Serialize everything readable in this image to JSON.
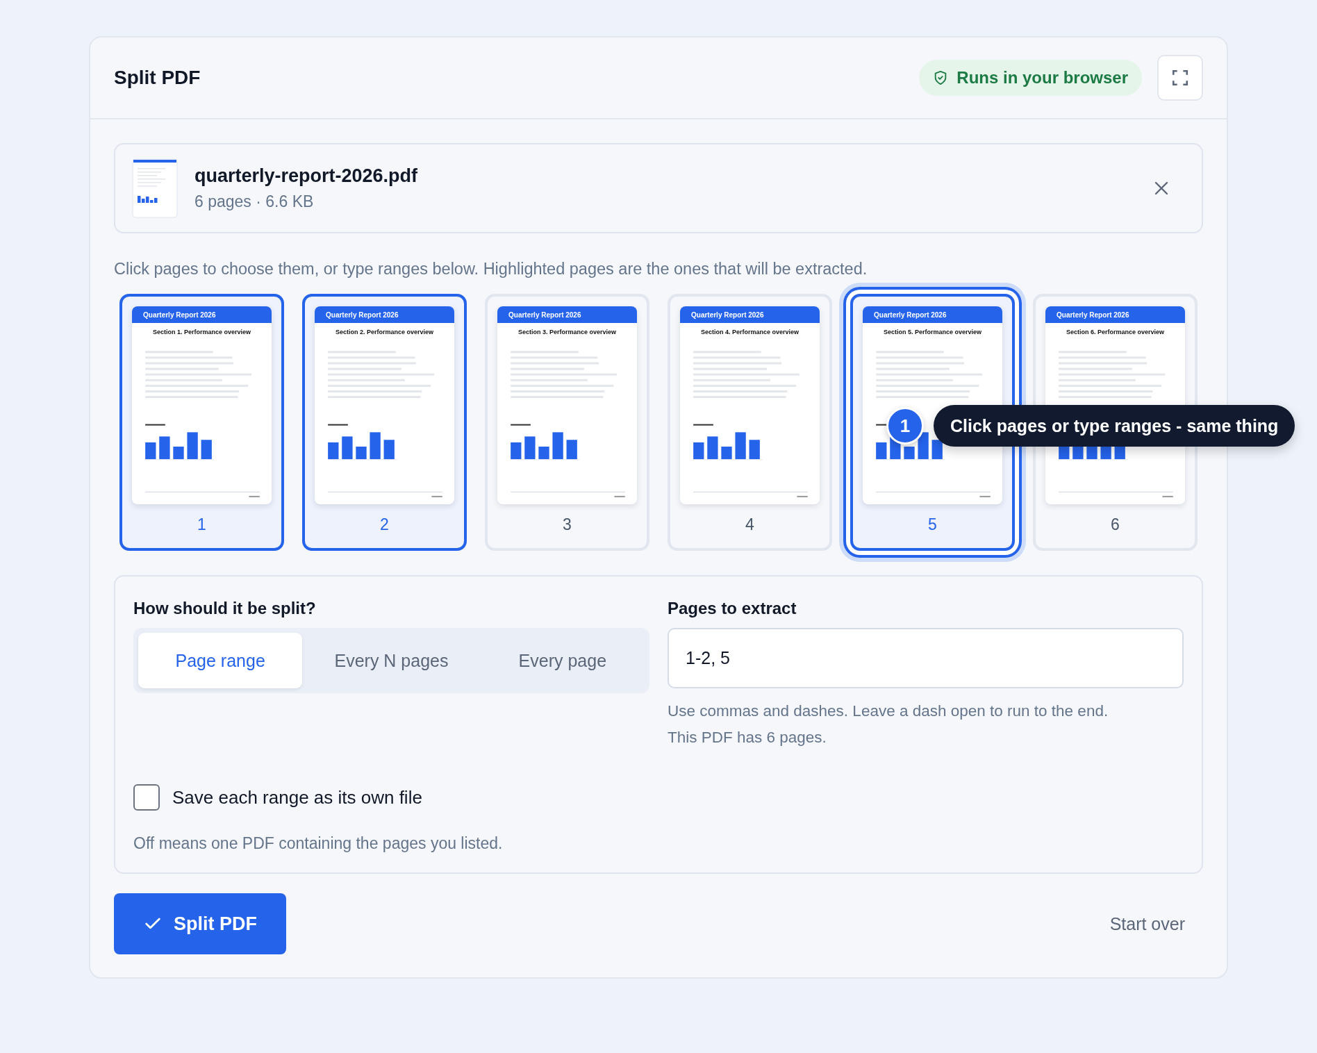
{
  "header": {
    "title": "Split PDF",
    "badge": "Runs in your browser"
  },
  "file": {
    "name": "quarterly-report-2026.pdf",
    "meta": "6 pages · 6.6 KB"
  },
  "instruction": "Click pages to choose them, or type ranges below. Highlighted pages are the ones that will be extracted.",
  "pages": [
    {
      "number": "1",
      "title": "Quarterly Report 2026",
      "section": "Section 1. Performance overview",
      "selected": true,
      "focused": false
    },
    {
      "number": "2",
      "title": "Quarterly Report 2026",
      "section": "Section 2. Performance overview",
      "selected": true,
      "focused": false
    },
    {
      "number": "3",
      "title": "Quarterly Report 2026",
      "section": "Section 3. Performance overview",
      "selected": false,
      "focused": false
    },
    {
      "number": "4",
      "title": "Quarterly Report 2026",
      "section": "Section 4. Performance overview",
      "selected": false,
      "focused": false
    },
    {
      "number": "5",
      "title": "Quarterly Report 2026",
      "section": "Section 5. Performance overview",
      "selected": true,
      "focused": true
    },
    {
      "number": "6",
      "title": "Quarterly Report 2026",
      "section": "Section 6. Performance overview",
      "selected": false,
      "focused": false
    }
  ],
  "tooltip": {
    "step": "1",
    "text": "Click pages or type ranges - same thing"
  },
  "split": {
    "heading": "How should it be split?",
    "modes": [
      {
        "label": "Page range",
        "selected": true
      },
      {
        "label": "Every N pages",
        "selected": false
      },
      {
        "label": "Every page",
        "selected": false
      }
    ],
    "range_label": "Pages to extract",
    "range_value": "1-2, 5",
    "help": [
      "Use commas and dashes. Leave a dash open to run to the end.",
      "This PDF has 6 pages."
    ],
    "checkbox": {
      "label": "Save each range as its own file",
      "checked": false
    },
    "note": "Off means one PDF containing the pages you listed."
  },
  "actions": {
    "primary": "Split PDF",
    "secondary": "Start over"
  }
}
